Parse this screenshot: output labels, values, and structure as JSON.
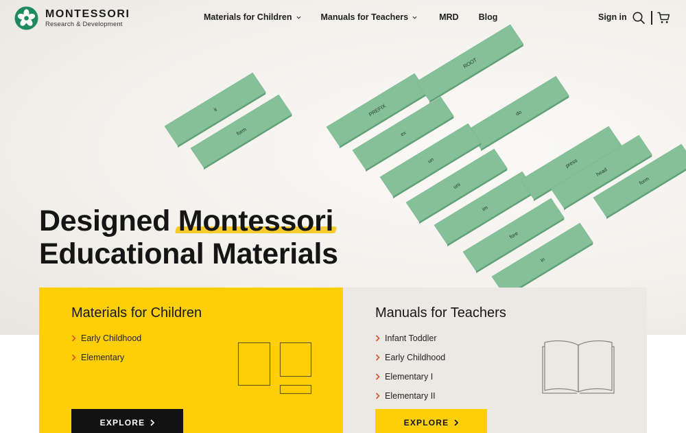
{
  "brand": {
    "name": "MONTESSORI",
    "tagline": "Research & Development",
    "logo_icon": "montessori-flower-logo",
    "colors": {
      "primary_green": "#1f8a5e",
      "accent_yellow": "#ffcf05",
      "card_gray": "#ece9e5"
    }
  },
  "nav": {
    "items": [
      {
        "label": "Materials for Children",
        "dropdown": true
      },
      {
        "label": "Manuals for Teachers",
        "dropdown": true
      },
      {
        "label": "MRD",
        "dropdown": false
      },
      {
        "label": "Blog",
        "dropdown": false
      }
    ],
    "sign_in": "Sign in",
    "icons": [
      "search-icon",
      "cart-icon"
    ]
  },
  "hero": {
    "headline_line1_a": "Designed ",
    "headline_line1_highlight": "Montessori",
    "headline_line2": "Educational Materials",
    "card_words": [
      "it",
      "form",
      "PREFIX",
      "ROOT",
      "ex",
      "do",
      "un",
      "uni",
      "im",
      "fore",
      "in",
      "press",
      "head",
      "form"
    ]
  },
  "cards": [
    {
      "title": "Materials for Children",
      "items": [
        "Early Childhood",
        "Elementary"
      ],
      "button": "EXPLORE",
      "icon": "frames-icon"
    },
    {
      "title": "Manuals for Teachers",
      "items": [
        "Infant Toddler",
        "Early Childhood",
        "Elementary I",
        "Elementary II"
      ],
      "button": "EXPLORE",
      "icon": "open-book-icon"
    }
  ]
}
